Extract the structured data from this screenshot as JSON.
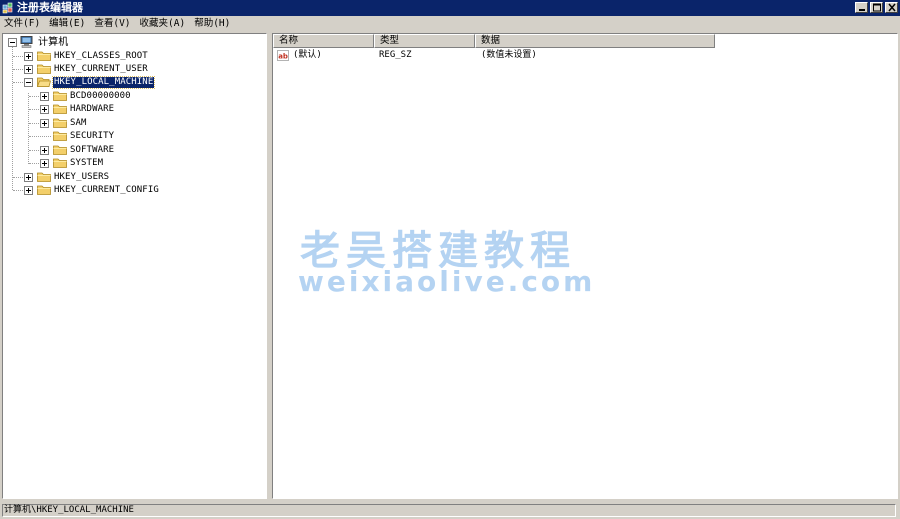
{
  "window": {
    "title": "注册表编辑器"
  },
  "menu": [
    "文件(F)",
    "编辑(E)",
    "查看(V)",
    "收藏夹(A)",
    "帮助(H)"
  ],
  "tree": {
    "root": "计算机",
    "hives": [
      {
        "label": "HKEY_CLASSES_ROOT",
        "expander": "+"
      },
      {
        "label": "HKEY_CURRENT_USER",
        "expander": "+"
      },
      {
        "label": "HKEY_LOCAL_MACHINE",
        "expander": "-",
        "selected": true
      },
      {
        "label": "BCD00000000",
        "expander": "+",
        "child": true
      },
      {
        "label": "HARDWARE",
        "expander": "+",
        "child": true
      },
      {
        "label": "SAM",
        "expander": "+",
        "child": true
      },
      {
        "label": "SECURITY",
        "expander": "",
        "child": true
      },
      {
        "label": "SOFTWARE",
        "expander": "+",
        "child": true
      },
      {
        "label": "SYSTEM",
        "expander": "+",
        "child": true
      },
      {
        "label": "HKEY_USERS",
        "expander": "+"
      },
      {
        "label": "HKEY_CURRENT_CONFIG",
        "expander": "+"
      }
    ]
  },
  "list": {
    "columns": [
      "名称",
      "类型",
      "数据"
    ],
    "rows": [
      {
        "name": "(默认)",
        "type": "REG_SZ",
        "data": "(数值未设置)"
      }
    ]
  },
  "watermark": {
    "line1": "老吴搭建教程",
    "line2": "weixiaolive.com"
  },
  "status": {
    "path": "计算机\\HKEY_LOCAL_MACHINE"
  },
  "colors": {
    "titlebar": "#0a246a",
    "selection": "#0a246a",
    "chrome": "#d4d0c8",
    "folder": "#f3cf6a"
  }
}
